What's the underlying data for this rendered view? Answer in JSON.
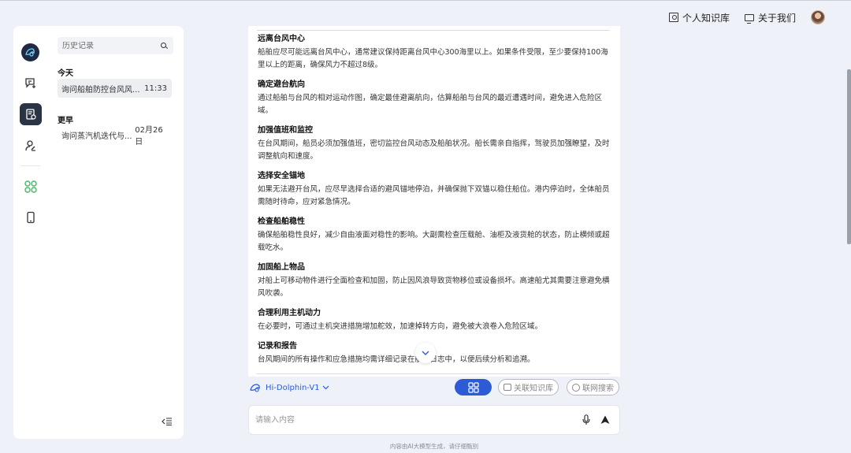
{
  "header": {
    "knowledge_label": "个人知识库",
    "about_label": "关于我们"
  },
  "sidebar": {
    "search_placeholder": "历史记录",
    "groups": [
      {
        "title": "今天",
        "items": [
          {
            "title": "询问船舶防控台风风...",
            "time": "11:33"
          }
        ]
      },
      {
        "title": "更早",
        "items": [
          {
            "title": "询问蒸汽机迭代与...",
            "time": "02月26日"
          }
        ]
      }
    ]
  },
  "chat": {
    "sections": [
      {
        "title": "远离台风中心",
        "body": "船舶应尽可能远离台风中心，通常建议保持距离台风中心300海里以上。如果条件受限，至少要保持100海里以上的距离，确保风力不超过8级。"
      },
      {
        "title": "确定避台航向",
        "body": "通过船舶与台风的相对运动作图，确定最佳避离航向，估算船舶与台风的最近遭遇时间，避免进入危险区域。"
      },
      {
        "title": "加强值班和监控",
        "body": "在台风期间，船员必须加强值班，密切监控台风动态及船舶状况。船长需亲自指挥，驾驶员加强瞭望，及时调整航向和速度。"
      },
      {
        "title": "选择安全锚地",
        "body": "如果无法避开台风，应尽早选择合适的避风锚地停泊，并确保抛下双锚以稳住船位。港内停泊时，全体船员需随时待命，应对紧急情况。"
      },
      {
        "title": "检查船舶稳性",
        "body": "确保船舶稳性良好，减少自由液面对稳性的影响。大副需检查压载舱、油柜及液货舱的状态，防止横倾或超载吃水。"
      },
      {
        "title": "加固船上物品",
        "body": "对船上可移动物件进行全面检查和加固，防止因风浪导致货物移位或设备损坏。高速船尤其需要注意避免横风吹袭。"
      },
      {
        "title": "合理利用主机动力",
        "body": "在必要时，可通过主机突进措施增加舵效，加速掉转方向，避免被大浪卷入危险区域。"
      },
      {
        "title": "记录和报告",
        "body": "台风期间的所有操作和应急措施均需详细记录在航海日志中，以便后续分析和追溯。"
      }
    ]
  },
  "toolbar": {
    "model_name": "Hi-Dolphin-V1",
    "kb_label": "关联知识库",
    "web_label": "联网搜索"
  },
  "composer": {
    "placeholder": "请输入内容"
  },
  "footer": {
    "disclaimer": "内容由AI大模型生成，请仔细甄别"
  },
  "colors": {
    "accent": "#2d5bd6",
    "rail_active": "#2b3445",
    "page_bg": "#eef1f8"
  }
}
